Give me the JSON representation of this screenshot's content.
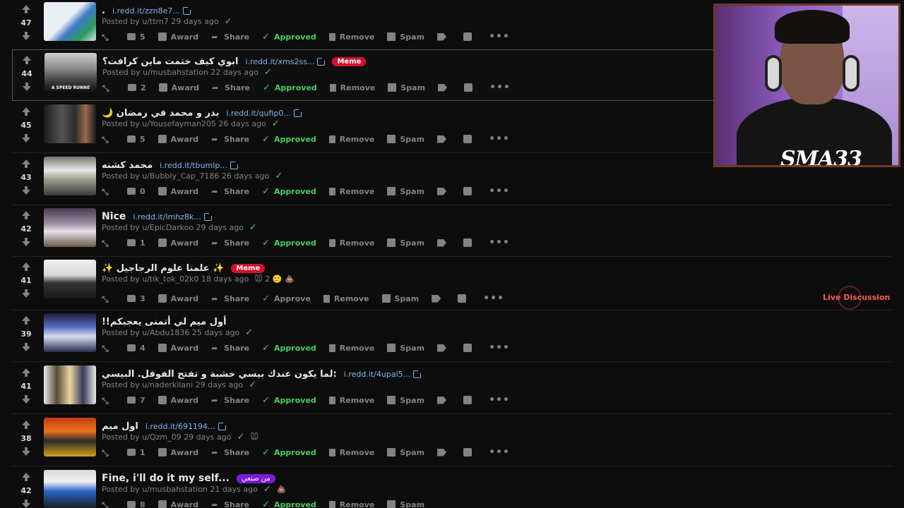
{
  "actions": {
    "award": "Award",
    "share": "Share",
    "approved": "Approved",
    "approve": "Approve",
    "remove": "Remove",
    "spam": "Spam",
    "more": "•••"
  },
  "posts": [
    {
      "score": "47",
      "title": ".",
      "domain": "i.redd.it/zzn8e7...",
      "flair": "",
      "meta": "Posted by u/ttrn7 29 days ago",
      "extra": "",
      "comments": "5",
      "approved": true
    },
    {
      "score": "44",
      "title": "ابوي كيف ختمت ماين كرافت؟",
      "domain": "i.redd.it/xms2ss...",
      "flair": "Meme",
      "meta": "Posted by u/musbahstation 22 days ago",
      "extra": "",
      "comments": "2",
      "approved": true
    },
    {
      "score": "45",
      "title": "🌙 بدر و محمد في رمضان",
      "domain": "i.redd.it/qufip0...",
      "flair": "",
      "meta": "Posted by u/Yousefayman205 26 days ago",
      "extra": "",
      "comments": "5",
      "approved": true
    },
    {
      "score": "43",
      "title": "محمد كشنه",
      "domain": "i.redd.it/tbumlp...",
      "flair": "",
      "meta": "Posted by u/Bubbly_Cap_7186 26 days ago",
      "extra": "",
      "comments": "0",
      "approved": true
    },
    {
      "score": "42",
      "title": "Nice",
      "domain": "i.redd.it/lmhz8k...",
      "flair": "",
      "meta": "Posted by u/EpicDarkoo 29 days ago",
      "extra": "",
      "comments": "1",
      "approved": true
    },
    {
      "score": "41",
      "title": "✨ علمنا علوم الرجاجيل ✨",
      "domain": "",
      "flair": "Meme",
      "meta": "Posted by u/tik_tok_02k0 18 days ago",
      "extra": "🐭 2 🙂 💩",
      "comments": "3",
      "approved": false
    },
    {
      "score": "39",
      "title": "!!أول ميم لي أتمنى يعجبكم",
      "domain": "",
      "flair": "",
      "meta": "Posted by u/Abdu1836 25 days ago",
      "extra": "",
      "comments": "4",
      "approved": true
    },
    {
      "score": "41",
      "title": "لما يكون عندك بيسي خشبة و تفتح الفوفل. البيسي:",
      "domain": "i.redd.it/4upal5...",
      "flair": "",
      "meta": "Posted by u/naderkilani 29 days ago",
      "extra": "",
      "comments": "7",
      "approved": true
    },
    {
      "score": "38",
      "title": "اول ميم",
      "domain": "i.redd.it/691194...",
      "flair": "",
      "meta": "Posted by u/Qzm_09 29 days ago",
      "extra": "🐭",
      "comments": "1",
      "approved": true
    },
    {
      "score": "42",
      "title": "Fine, i'll do it my self...",
      "domain": "",
      "flair": "من صنعي",
      "meta": "Posted by u/musbahstation 21 days ago",
      "extra": "💩",
      "comments": "8",
      "approved": true
    }
  ],
  "thumb_text": {
    "p1": "A SPEED RUNNE"
  },
  "live_discussion": "Live Discussion",
  "webcam": {
    "logo": "SMA33"
  },
  "colors": {
    "approved": "#46d160",
    "flair_red": "#d4102a",
    "flair_purple": "#7b1bd6",
    "link": "#7fb7e8"
  }
}
